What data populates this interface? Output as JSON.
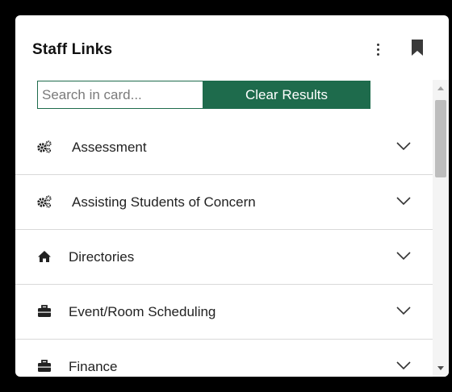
{
  "card": {
    "title": "Staff Links",
    "kebab_icon": "more-vertical-icon",
    "bookmark_icon": "bookmark-icon"
  },
  "search": {
    "placeholder": "Search in card...",
    "value": "",
    "clear_label": "Clear Results"
  },
  "items": [
    {
      "label": "Assessment",
      "icon": "gears-icon"
    },
    {
      "label": "Assisting Students of Concern",
      "icon": "gears-icon"
    },
    {
      "label": "Directories",
      "icon": "home-icon"
    },
    {
      "label": "Event/Room Scheduling",
      "icon": "briefcase-icon"
    },
    {
      "label": "Finance",
      "icon": "briefcase-icon"
    }
  ],
  "colors": {
    "accent": "#1e6b4c",
    "background": "#000000",
    "card": "#ffffff"
  }
}
